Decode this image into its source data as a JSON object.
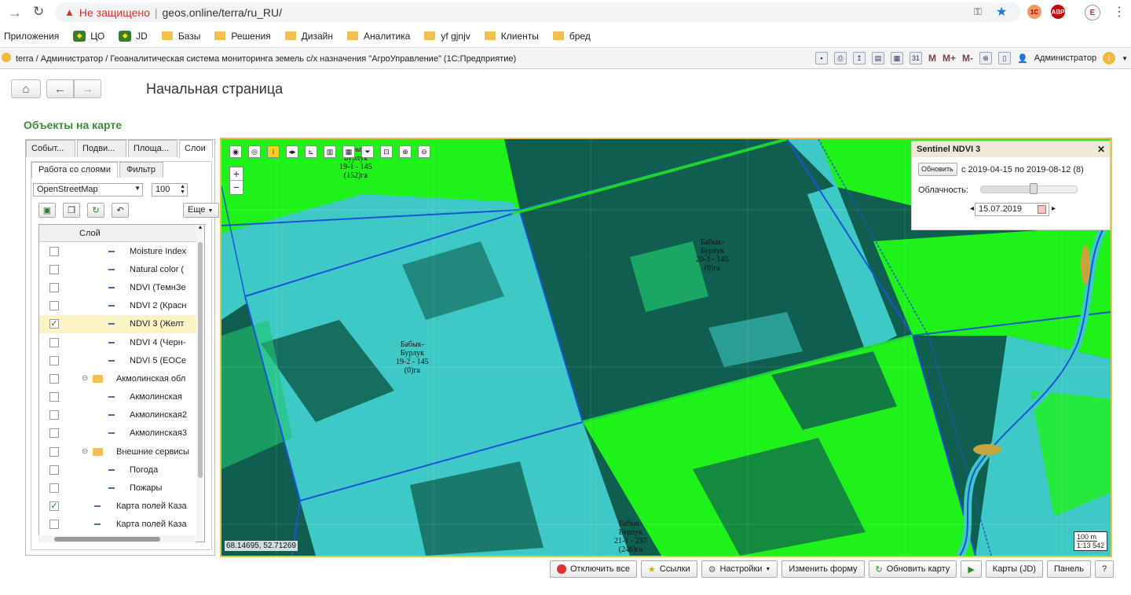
{
  "browser": {
    "insecure_label": "Не защищено",
    "url": "geos.online/terra/ru_RU/",
    "bookmarks": [
      "Приложения",
      "ЦО",
      "JD",
      "Базы",
      "Решения",
      "Дизайн",
      "Аналитика",
      "yf gjnjv",
      "Клиенты",
      "бред"
    ],
    "profile_initial": "E"
  },
  "app": {
    "title": "terra / Администратор / Геоаналитическая система мониторинга земель с/х назначения \"АгроУправление\"  (1С:Предприятие)",
    "user": "Администратор",
    "m_buttons": [
      "M",
      "M+",
      "M-"
    ]
  },
  "page": {
    "title": "Начальная страница",
    "section_title": "Объекты на карте"
  },
  "left_panel": {
    "tabs": [
      "Событ...",
      "Подви...",
      "Площа...",
      "Слои"
    ],
    "subtabs": [
      "Работа со слоями",
      "Фильтр"
    ],
    "basemap": "OpenStreetMap",
    "opacity": "100",
    "more_label": "Еще",
    "column_header": "Слой",
    "layers": [
      {
        "label": "Moisture Index",
        "checked": false,
        "level": 2,
        "kind": "layer"
      },
      {
        "label": "Natural color (",
        "checked": false,
        "level": 2,
        "kind": "layer"
      },
      {
        "label": "NDVI (ТемнЗе",
        "checked": false,
        "level": 2,
        "kind": "layer"
      },
      {
        "label": "NDVI 2 (Красн",
        "checked": false,
        "level": 2,
        "kind": "layer"
      },
      {
        "label": "NDVI 3 (Желт",
        "checked": true,
        "level": 2,
        "kind": "layer",
        "selected": true
      },
      {
        "label": "NDVI 4 (Черн-",
        "checked": false,
        "level": 2,
        "kind": "layer"
      },
      {
        "label": "NDVI 5 (EOCe",
        "checked": false,
        "level": 2,
        "kind": "layer"
      },
      {
        "label": "Акмолинская обл",
        "checked": false,
        "level": 1,
        "kind": "folder"
      },
      {
        "label": "Акмолинская",
        "checked": false,
        "level": 2,
        "kind": "layer"
      },
      {
        "label": "Акмолинская2",
        "checked": false,
        "level": 2,
        "kind": "layer"
      },
      {
        "label": "Акмолинская3",
        "checked": false,
        "level": 2,
        "kind": "layer"
      },
      {
        "label": "Внешние сервисы",
        "checked": false,
        "level": 1,
        "kind": "folder"
      },
      {
        "label": "Погода",
        "checked": false,
        "level": 2,
        "kind": "layer"
      },
      {
        "label": "Пожары",
        "checked": false,
        "level": 2,
        "kind": "layer"
      },
      {
        "label": "Карта полей Каза",
        "checked": true,
        "level": 1,
        "kind": "layer"
      },
      {
        "label": "Карта полей Каза",
        "checked": false,
        "level": 1,
        "kind": "layer"
      }
    ]
  },
  "map": {
    "coords": "68.14695, 52.71269",
    "scale_bar": "100 m",
    "scale_ratio": "1:13 542",
    "fields": [
      {
        "lines": [
          "Бабык-",
          "Бурлук",
          "19-1 - 145",
          "(152)га"
        ]
      },
      {
        "lines": [
          "Бабык-",
          "Бурлук",
          "20-3 - 145",
          "(0)га"
        ]
      },
      {
        "lines": [
          "Бабык-",
          "Бурлук",
          "19-2 - 145",
          "(0)га"
        ]
      },
      {
        "lines": [
          "Бабык-",
          "Бурлук",
          "21-1 - 237",
          "(246)га"
        ]
      }
    ],
    "colors": {
      "dark": "#0f5e4f",
      "cyan": "#3ec9c6",
      "green": "#1ff11a",
      "mid": "#22c470",
      "road": "#1a55d8"
    }
  },
  "sentinel": {
    "title": "Sentinel NDVI 3",
    "update_label": "Обновить",
    "period": "с 2019-04-15 по 2019-08-12 (8)",
    "cloud_label": "Облачность:",
    "cloud_value": 0.55,
    "date": "15.07.2019"
  },
  "bottom": {
    "buttons": [
      "Отключить все",
      "Ссылки",
      "Настройки",
      "Изменить форму",
      "Обновить карту",
      "Карты (JD)",
      "Панель",
      "?"
    ]
  }
}
